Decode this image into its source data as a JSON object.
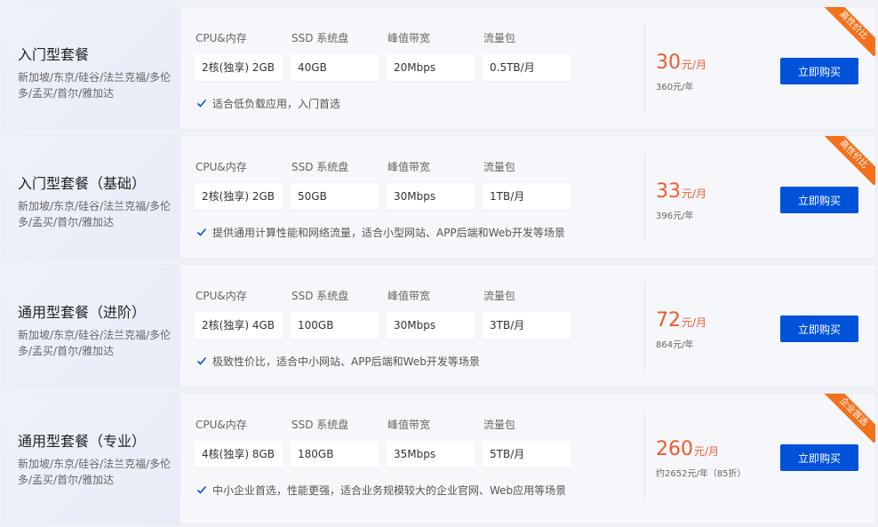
{
  "spec_labels": [
    "CPU&内存",
    "SSD 系统盘",
    "峰值带宽",
    "流量包"
  ],
  "plans": [
    {
      "title": "入门型套餐",
      "regions": "新加坡/东京/硅谷/法兰克福/多伦多/孟买/首尔/雅加达",
      "specs": [
        "2核(独享) 2GB",
        "40GB",
        "20Mbps",
        "0.5TB/月"
      ],
      "feature": "适合低负载应用，入门首选",
      "price": "30",
      "price_unit": "元/月",
      "price_year": "360元/年",
      "buy_label": "立即购买",
      "badge": "高性价比"
    },
    {
      "title": "入门型套餐（基础）",
      "regions": "新加坡/东京/硅谷/法兰克福/多伦多/孟买/首尔/雅加达",
      "specs": [
        "2核(独享) 2GB",
        "50GB",
        "30Mbps",
        "1TB/月"
      ],
      "feature": "提供通用计算性能和网络流量，适合小型网站、APP后端和Web开发等场景",
      "price": "33",
      "price_unit": "元/月",
      "price_year": "396元/年",
      "buy_label": "立即购买",
      "badge": "高性价比"
    },
    {
      "title": "通用型套餐（进阶）",
      "regions": "新加坡/东京/硅谷/法兰克福/多伦多/孟买/首尔/雅加达",
      "specs": [
        "2核(独享) 4GB",
        "100GB",
        "30Mbps",
        "3TB/月"
      ],
      "feature": "极致性价比，适合中小网站、APP后端和Web开发等场景",
      "price": "72",
      "price_unit": "元/月",
      "price_year": "864元/年",
      "buy_label": "立即购买",
      "badge": ""
    },
    {
      "title": "通用型套餐（专业）",
      "regions": "新加坡/东京/硅谷/法兰克福/多伦多/孟买/首尔/雅加达",
      "specs": [
        "4核(独享) 8GB",
        "180GB",
        "35Mbps",
        "5TB/月"
      ],
      "feature": "中小企业首选，性能更强，适合业务规模较大的企业官网、Web应用等场景",
      "price": "260",
      "price_unit": "元/月",
      "price_year": "约2652元/年（85折）",
      "buy_label": "立即购买",
      "badge": "企业首选"
    }
  ],
  "colors": {
    "accent": "#0052d9",
    "price": "#f15a2b",
    "badge": "#f5701b",
    "check": "#0052d9"
  },
  "icons": {
    "feature": "check-icon"
  }
}
